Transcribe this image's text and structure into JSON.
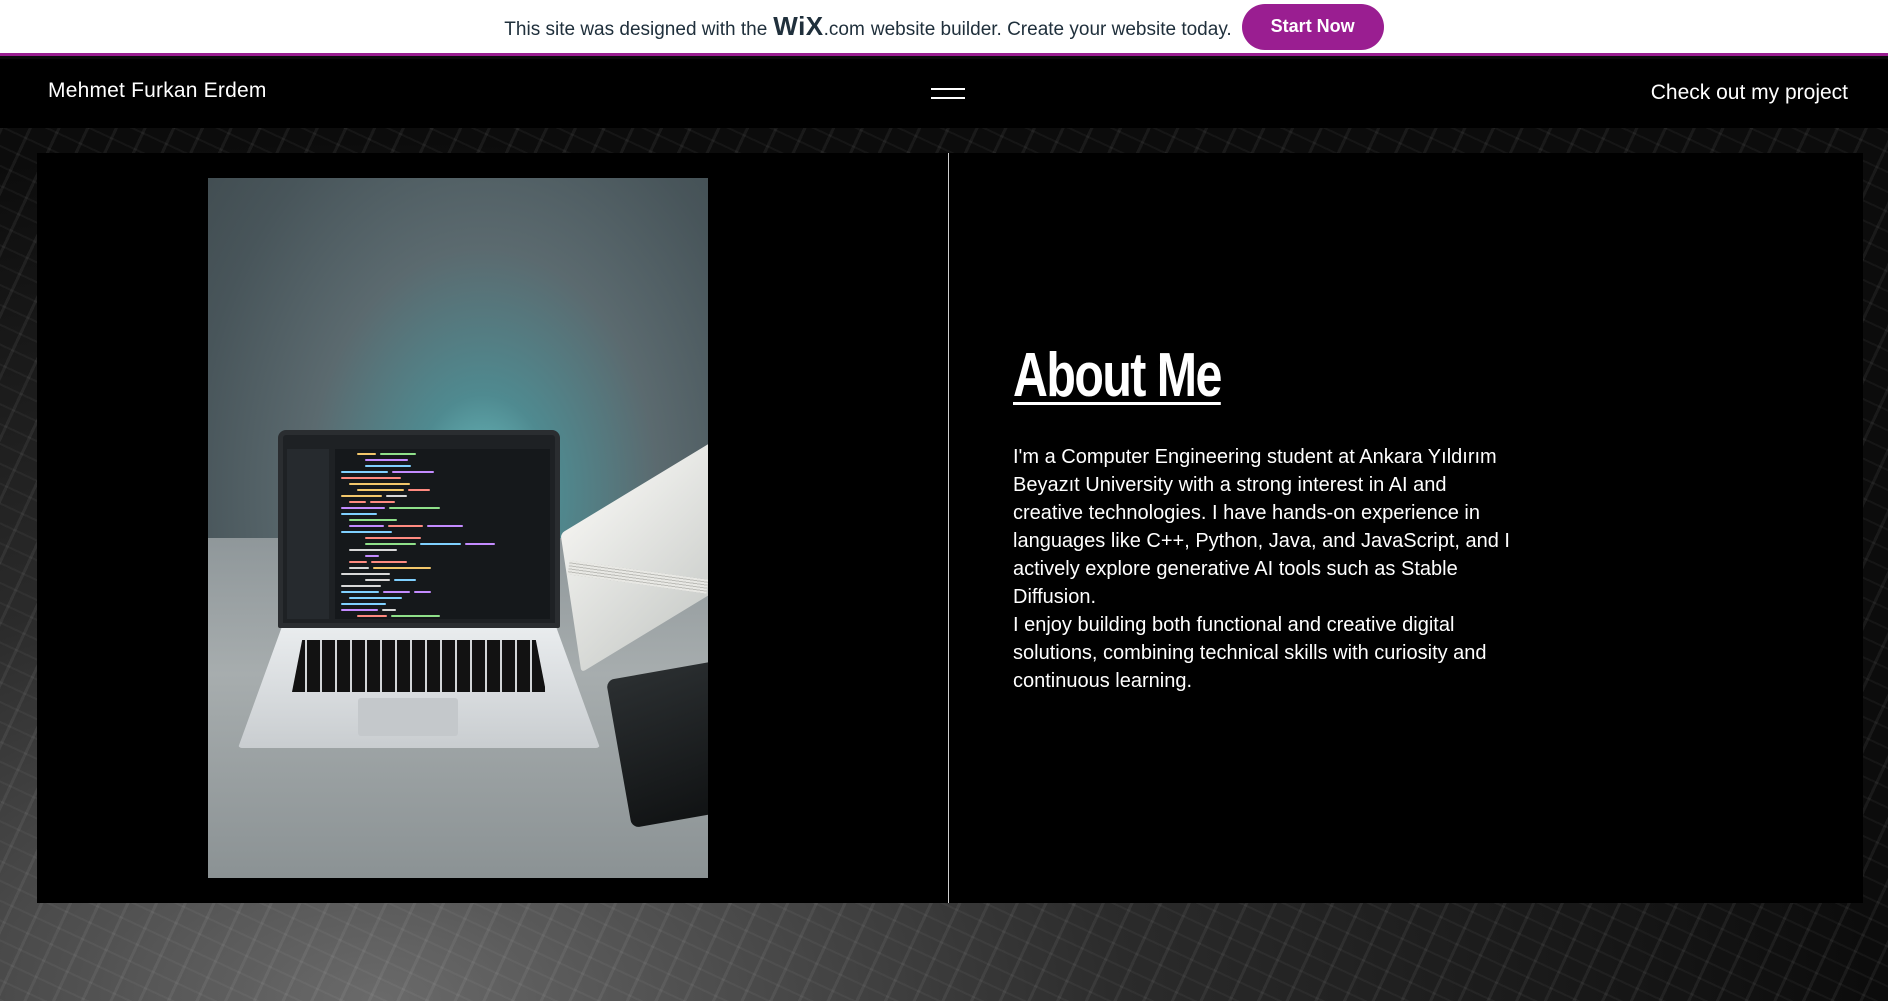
{
  "banner": {
    "text_before": "This site was designed with the",
    "wix_logo": "WiX",
    "wix_dotcom": ".com",
    "text_after": "website builder. Create your website today.",
    "start_label": "Start Now",
    "accent_color": "#9a1e91"
  },
  "header": {
    "site_name": "Mehmet Furkan Erdem",
    "menu_icon": "hamburger-menu-icon",
    "project_link": "Check out my project"
  },
  "about": {
    "title": "About Me",
    "paragraph1": "I'm a Computer Engineering student at Ankara Yıldırım Beyazıt University with a strong interest in AI and creative technologies. I have hands-on experience in languages like C++, Python, Java, and JavaScript, and I actively explore generative AI tools such as Stable Diffusion.",
    "paragraph2": "I enjoy building both functional and creative digital solutions, combining technical skills with curiosity and continuous learning."
  },
  "image": {
    "alt": "Laptop with code on screen"
  }
}
